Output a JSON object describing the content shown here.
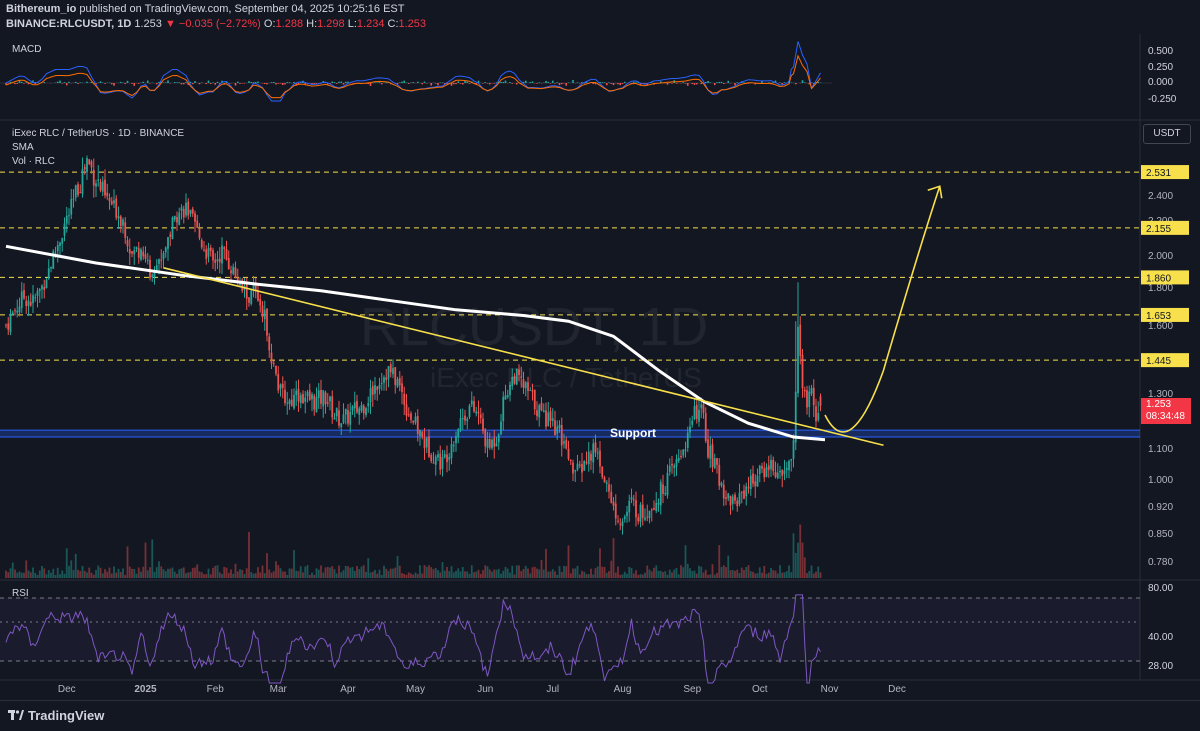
{
  "header": {
    "publisher": "Bithereum_io",
    "published_text": "published on TradingView.com, September 04, 2025 10:25:16 EST",
    "symbol_line": "BINANCE:RLCUSDT, 1D",
    "last": "1.253",
    "change": "−0.035 (−2.72%)",
    "o_label": "O:",
    "o": "1.288",
    "h_label": "H:",
    "h": "1.298",
    "l_label": "L:",
    "l": "1.234",
    "c_label": "C:",
    "c": "1.253"
  },
  "macd": {
    "label": "MACD",
    "ticks": [
      "0.500",
      "0.250",
      "0.000",
      "-0.250"
    ]
  },
  "main": {
    "title": "iExec RLC / TetherUS · 1D · BINANCE",
    "sma_label": "SMA",
    "vol_label": "Vol · RLC",
    "currency": "USDT",
    "watermark_symbol": "RLCUSDT, 1D",
    "watermark_name": "iExec RLC / TetherUS",
    "support_label": "Support",
    "price_badge": "1.253",
    "countdown": "08:34:48"
  },
  "rsi": {
    "label": "RSI",
    "ticks": [
      "80.00",
      "40.00",
      "28.00"
    ]
  },
  "footer": {
    "logo": "TradingView"
  },
  "chart_data": {
    "type": "candlestick",
    "symbol": "RLCUSDT",
    "interval": "1D",
    "y_ticks": [
      "2.400",
      "2.200",
      "2.000",
      "1.800",
      "1.600",
      "1.300",
      "1.100",
      "1.000",
      "0.920",
      "0.850",
      "0.780"
    ],
    "levels": [
      {
        "value": 2.531,
        "label": "2.531"
      },
      {
        "value": 2.155,
        "label": "2.155"
      },
      {
        "value": 1.86,
        "label": "1.860"
      },
      {
        "value": 1.653,
        "label": "1.653"
      },
      {
        "value": 1.445,
        "label": "1.445"
      }
    ],
    "support_zone": [
      1.14,
      1.165
    ],
    "x_ticks": [
      "Dec",
      "2025",
      "Feb",
      "Mar",
      "Apr",
      "May",
      "Jun",
      "Jul",
      "Aug",
      "Sep",
      "Oct",
      "Nov",
      "Dec"
    ],
    "close_path": [
      [
        0,
        1.6
      ],
      [
        4,
        1.68
      ],
      [
        8,
        1.75
      ],
      [
        12,
        1.72
      ],
      [
        16,
        1.8
      ],
      [
        20,
        1.95
      ],
      [
        24,
        2.1
      ],
      [
        28,
        2.25
      ],
      [
        32,
        2.45
      ],
      [
        36,
        2.6
      ],
      [
        40,
        2.5
      ],
      [
        44,
        2.38
      ],
      [
        48,
        2.3
      ],
      [
        52,
        2.2
      ],
      [
        56,
        2.0
      ],
      [
        60,
        2.05
      ],
      [
        64,
        1.9
      ],
      [
        68,
        1.95
      ],
      [
        72,
        2.1
      ],
      [
        76,
        2.25
      ],
      [
        80,
        2.3
      ],
      [
        84,
        2.15
      ],
      [
        88,
        2.05
      ],
      [
        92,
        1.95
      ],
      [
        96,
        2.02
      ],
      [
        100,
        1.93
      ],
      [
        104,
        1.8
      ],
      [
        108,
        1.75
      ],
      [
        110,
        1.8
      ],
      [
        112,
        1.75
      ],
      [
        116,
        1.6
      ],
      [
        118,
        1.45
      ],
      [
        122,
        1.3
      ],
      [
        126,
        1.27
      ],
      [
        130,
        1.3
      ],
      [
        134,
        1.28
      ],
      [
        138,
        1.27
      ],
      [
        142,
        1.29
      ],
      [
        146,
        1.22
      ],
      [
        150,
        1.2
      ],
      [
        154,
        1.23
      ],
      [
        158,
        1.25
      ],
      [
        162,
        1.3
      ],
      [
        166,
        1.36
      ],
      [
        170,
        1.4
      ],
      [
        174,
        1.35
      ],
      [
        178,
        1.25
      ],
      [
        182,
        1.18
      ],
      [
        186,
        1.12
      ],
      [
        190,
        1.08
      ],
      [
        194,
        1.05
      ],
      [
        198,
        1.12
      ],
      [
        202,
        1.2
      ],
      [
        206,
        1.25
      ],
      [
        210,
        1.22
      ],
      [
        214,
        1.1
      ],
      [
        218,
        1.14
      ],
      [
        222,
        1.3
      ],
      [
        226,
        1.38
      ],
      [
        230,
        1.33
      ],
      [
        234,
        1.28
      ],
      [
        238,
        1.22
      ],
      [
        242,
        1.2
      ],
      [
        246,
        1.15
      ],
      [
        250,
        1.05
      ],
      [
        254,
        1.02
      ],
      [
        258,
        1.06
      ],
      [
        262,
        1.1
      ],
      [
        266,
        1.0
      ],
      [
        270,
        0.92
      ],
      [
        274,
        0.88
      ],
      [
        278,
        0.93
      ],
      [
        282,
        0.9
      ],
      [
        286,
        0.92
      ],
      [
        290,
        0.95
      ],
      [
        294,
        1.0
      ],
      [
        298,
        1.05
      ],
      [
        302,
        1.12
      ],
      [
        306,
        1.22
      ],
      [
        308,
        1.25
      ],
      [
        310,
        1.2
      ],
      [
        312,
        1.1
      ],
      [
        316,
        1.02
      ],
      [
        320,
        0.95
      ],
      [
        324,
        0.93
      ],
      [
        328,
        0.97
      ],
      [
        332,
        1.0
      ],
      [
        336,
        1.02
      ],
      [
        340,
        1.05
      ],
      [
        344,
        1.0
      ],
      [
        348,
        1.05
      ],
      [
        350,
        1.1
      ],
      [
        352,
        1.55
      ],
      [
        354,
        1.35
      ],
      [
        356,
        1.25
      ],
      [
        358,
        1.3
      ],
      [
        360,
        1.22
      ],
      [
        362,
        1.253
      ]
    ],
    "sma": [
      [
        0,
        2.05
      ],
      [
        40,
        1.95
      ],
      [
        80,
        1.87
      ],
      [
        110,
        1.82
      ],
      [
        140,
        1.78
      ],
      [
        170,
        1.73
      ],
      [
        200,
        1.68
      ],
      [
        230,
        1.65
      ],
      [
        250,
        1.62
      ],
      [
        270,
        1.55
      ],
      [
        290,
        1.4
      ],
      [
        310,
        1.27
      ],
      [
        330,
        1.19
      ],
      [
        350,
        1.14
      ],
      [
        364,
        1.13
      ]
    ],
    "trendline": [
      [
        70,
        1.92
      ],
      [
        390,
        1.11
      ]
    ],
    "projection": [
      [
        364,
        1.22
      ],
      [
        375,
        1.15
      ],
      [
        390,
        1.4
      ],
      [
        405,
        2.0
      ],
      [
        415,
        2.45
      ]
    ],
    "x_month_starts": [
      {
        "label": "Dec",
        "t": 27
      },
      {
        "label": "2025",
        "t": 62
      },
      {
        "label": "Feb",
        "t": 93
      },
      {
        "label": "Mar",
        "t": 121
      },
      {
        "label": "Apr",
        "t": 152
      },
      {
        "label": "May",
        "t": 182
      },
      {
        "label": "Jun",
        "t": 213
      },
      {
        "label": "Jul",
        "t": 243
      },
      {
        "label": "Aug",
        "t": 274
      },
      {
        "label": "Sep",
        "t": 305
      },
      {
        "label": "Oct",
        "t": 335
      },
      {
        "label": "Nov",
        "t": 366
      },
      {
        "label": "Dec",
        "t": 396
      }
    ]
  }
}
